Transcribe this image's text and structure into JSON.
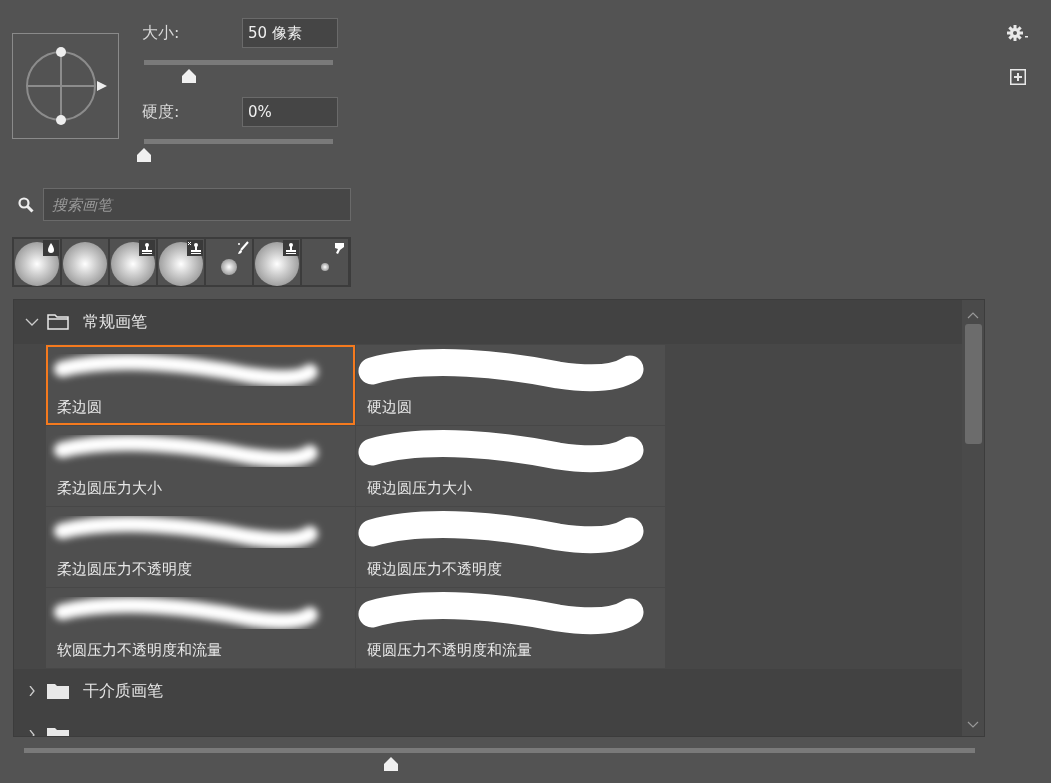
{
  "size": {
    "label": "大小:",
    "value": "50 像素",
    "level": 0.24
  },
  "hardness": {
    "label": "硬度:",
    "value": "0%",
    "level": 0
  },
  "search": {
    "placeholder": "搜索画笔"
  },
  "presets": [
    {
      "kind": "drop"
    },
    {
      "kind": "none"
    },
    {
      "kind": "stamp"
    },
    {
      "kind": "stamp-x"
    },
    {
      "kind": "brush"
    },
    {
      "kind": "stamp"
    },
    {
      "kind": "smudge"
    }
  ],
  "groups": [
    {
      "name": "常规画笔",
      "expanded": true,
      "brushes": [
        {
          "name": "柔边圆",
          "kind": "soft",
          "selected": true
        },
        {
          "name": "硬边圆",
          "kind": "hard",
          "selected": false
        },
        {
          "name": "柔边圆压力大小",
          "kind": "soft",
          "selected": false
        },
        {
          "name": "硬边圆压力大小",
          "kind": "hard",
          "selected": false
        },
        {
          "name": "柔边圆压力不透明度",
          "kind": "soft",
          "selected": false
        },
        {
          "name": "硬边圆压力不透明度",
          "kind": "hard",
          "selected": false
        },
        {
          "name": "软圆压力不透明度和流量",
          "kind": "soft",
          "selected": false
        },
        {
          "name": "硬圆压力不透明度和流量",
          "kind": "hard",
          "selected": false
        }
      ]
    },
    {
      "name": "干介质画笔",
      "expanded": false
    },
    {
      "expanded": false
    }
  ],
  "thumbnail_size": {
    "level": 0.386
  }
}
